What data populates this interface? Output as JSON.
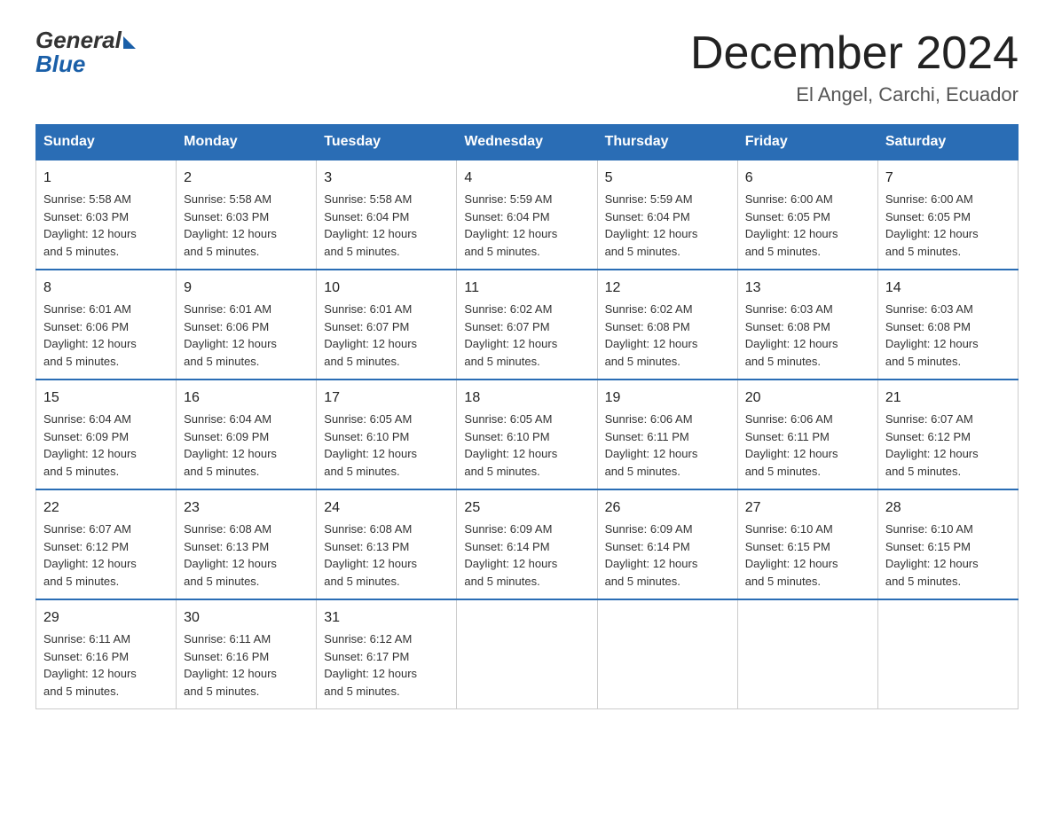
{
  "logo": {
    "text_general": "General",
    "text_blue": "Blue"
  },
  "header": {
    "month_year": "December 2024",
    "location": "El Angel, Carchi, Ecuador"
  },
  "days_of_week": [
    "Sunday",
    "Monday",
    "Tuesday",
    "Wednesday",
    "Thursday",
    "Friday",
    "Saturday"
  ],
  "weeks": [
    [
      {
        "day": "1",
        "sunrise": "5:58 AM",
        "sunset": "6:03 PM",
        "daylight": "12 hours and 5 minutes."
      },
      {
        "day": "2",
        "sunrise": "5:58 AM",
        "sunset": "6:03 PM",
        "daylight": "12 hours and 5 minutes."
      },
      {
        "day": "3",
        "sunrise": "5:58 AM",
        "sunset": "6:04 PM",
        "daylight": "12 hours and 5 minutes."
      },
      {
        "day": "4",
        "sunrise": "5:59 AM",
        "sunset": "6:04 PM",
        "daylight": "12 hours and 5 minutes."
      },
      {
        "day": "5",
        "sunrise": "5:59 AM",
        "sunset": "6:04 PM",
        "daylight": "12 hours and 5 minutes."
      },
      {
        "day": "6",
        "sunrise": "6:00 AM",
        "sunset": "6:05 PM",
        "daylight": "12 hours and 5 minutes."
      },
      {
        "day": "7",
        "sunrise": "6:00 AM",
        "sunset": "6:05 PM",
        "daylight": "12 hours and 5 minutes."
      }
    ],
    [
      {
        "day": "8",
        "sunrise": "6:01 AM",
        "sunset": "6:06 PM",
        "daylight": "12 hours and 5 minutes."
      },
      {
        "day": "9",
        "sunrise": "6:01 AM",
        "sunset": "6:06 PM",
        "daylight": "12 hours and 5 minutes."
      },
      {
        "day": "10",
        "sunrise": "6:01 AM",
        "sunset": "6:07 PM",
        "daylight": "12 hours and 5 minutes."
      },
      {
        "day": "11",
        "sunrise": "6:02 AM",
        "sunset": "6:07 PM",
        "daylight": "12 hours and 5 minutes."
      },
      {
        "day": "12",
        "sunrise": "6:02 AM",
        "sunset": "6:08 PM",
        "daylight": "12 hours and 5 minutes."
      },
      {
        "day": "13",
        "sunrise": "6:03 AM",
        "sunset": "6:08 PM",
        "daylight": "12 hours and 5 minutes."
      },
      {
        "day": "14",
        "sunrise": "6:03 AM",
        "sunset": "6:08 PM",
        "daylight": "12 hours and 5 minutes."
      }
    ],
    [
      {
        "day": "15",
        "sunrise": "6:04 AM",
        "sunset": "6:09 PM",
        "daylight": "12 hours and 5 minutes."
      },
      {
        "day": "16",
        "sunrise": "6:04 AM",
        "sunset": "6:09 PM",
        "daylight": "12 hours and 5 minutes."
      },
      {
        "day": "17",
        "sunrise": "6:05 AM",
        "sunset": "6:10 PM",
        "daylight": "12 hours and 5 minutes."
      },
      {
        "day": "18",
        "sunrise": "6:05 AM",
        "sunset": "6:10 PM",
        "daylight": "12 hours and 5 minutes."
      },
      {
        "day": "19",
        "sunrise": "6:06 AM",
        "sunset": "6:11 PM",
        "daylight": "12 hours and 5 minutes."
      },
      {
        "day": "20",
        "sunrise": "6:06 AM",
        "sunset": "6:11 PM",
        "daylight": "12 hours and 5 minutes."
      },
      {
        "day": "21",
        "sunrise": "6:07 AM",
        "sunset": "6:12 PM",
        "daylight": "12 hours and 5 minutes."
      }
    ],
    [
      {
        "day": "22",
        "sunrise": "6:07 AM",
        "sunset": "6:12 PM",
        "daylight": "12 hours and 5 minutes."
      },
      {
        "day": "23",
        "sunrise": "6:08 AM",
        "sunset": "6:13 PM",
        "daylight": "12 hours and 5 minutes."
      },
      {
        "day": "24",
        "sunrise": "6:08 AM",
        "sunset": "6:13 PM",
        "daylight": "12 hours and 5 minutes."
      },
      {
        "day": "25",
        "sunrise": "6:09 AM",
        "sunset": "6:14 PM",
        "daylight": "12 hours and 5 minutes."
      },
      {
        "day": "26",
        "sunrise": "6:09 AM",
        "sunset": "6:14 PM",
        "daylight": "12 hours and 5 minutes."
      },
      {
        "day": "27",
        "sunrise": "6:10 AM",
        "sunset": "6:15 PM",
        "daylight": "12 hours and 5 minutes."
      },
      {
        "day": "28",
        "sunrise": "6:10 AM",
        "sunset": "6:15 PM",
        "daylight": "12 hours and 5 minutes."
      }
    ],
    [
      {
        "day": "29",
        "sunrise": "6:11 AM",
        "sunset": "6:16 PM",
        "daylight": "12 hours and 5 minutes."
      },
      {
        "day": "30",
        "sunrise": "6:11 AM",
        "sunset": "6:16 PM",
        "daylight": "12 hours and 5 minutes."
      },
      {
        "day": "31",
        "sunrise": "6:12 AM",
        "sunset": "6:17 PM",
        "daylight": "12 hours and 5 minutes."
      },
      null,
      null,
      null,
      null
    ]
  ],
  "labels": {
    "sunrise": "Sunrise:",
    "sunset": "Sunset:",
    "daylight": "Daylight: 12 hours"
  }
}
